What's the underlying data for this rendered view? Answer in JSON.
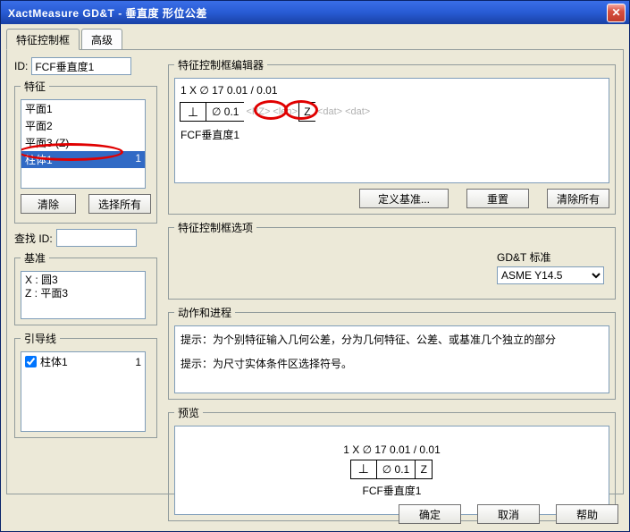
{
  "window": {
    "title": "XactMeasure GD&T - 垂直度 形位公差"
  },
  "tabs": {
    "main": "特征控制框",
    "advanced": "高级"
  },
  "left": {
    "id_label": "ID:",
    "id_value": "FCF垂直度1",
    "feat_legend": "特征",
    "features": [
      "平面1",
      "平面2",
      "平面3 (Z)"
    ],
    "feature_selected": {
      "name": "柱体1",
      "count": "1"
    },
    "clear": "清除",
    "select_all": "选择所有",
    "find_id": "查找 ID:",
    "datum_legend": "基准",
    "datums": [
      "X : 圆3",
      "Z : 平面3"
    ],
    "leader_legend": "引导线",
    "leader": {
      "name": "柱体1",
      "count": "1",
      "checked": true
    }
  },
  "editor": {
    "legend": "特征控制框编辑器",
    "line1": "1 X ∅ 17 0.01 / 0.01",
    "sym": "⊥",
    "dia": "∅",
    "tol": "0.1",
    "pz": "<PZ>",
    "len": "<len>",
    "datum1": "Z",
    "datp1": "<dat>",
    "datp2": "<dat>",
    "below": "FCF垂直度1",
    "define_datum": "定义基准...",
    "reset": "重置",
    "clear_all": "清除所有"
  },
  "options": {
    "legend": "特征控制框选项",
    "std_label": "GD&T 标准",
    "std_value": "ASME Y14.5"
  },
  "actions": {
    "legend": "动作和进程",
    "tip1": "提示：为个别特征输入几何公差，分为几何特征、公差、或基准几个独立的部分",
    "tip2": "提示：为尺寸实体条件区选择符号。"
  },
  "preview": {
    "legend": "预览",
    "line1": "1 X ∅ 17 0.01 / 0.01",
    "sym": "⊥",
    "dia": "∅",
    "tol": "0.1",
    "datum1": "Z",
    "below": "FCF垂直度1"
  },
  "dlg": {
    "ok": "确定",
    "cancel": "取消",
    "help": "帮助"
  }
}
